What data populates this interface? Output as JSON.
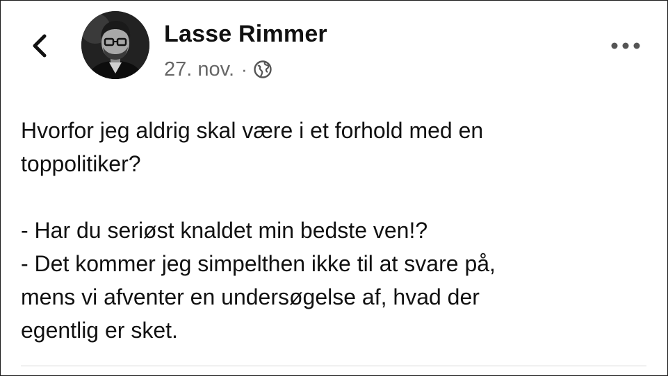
{
  "post": {
    "author_name": "Lasse Rimmer",
    "date": "27. nov.",
    "separator": "·",
    "privacy_icon": "globe-icon",
    "lines": [
      "Hvorfor jeg aldrig skal være i et forhold med en",
      "toppolitiker?",
      "",
      "- Har du seriøst knaldet min bedste ven!?",
      "- Det kommer jeg simpelthen ikke til at svare på,",
      "mens vi afventer en undersøgelse af, hvad der",
      "egentlig er sket."
    ]
  },
  "header": {
    "back_icon": "chevron-left-icon",
    "more_icon": "more-dots-icon"
  },
  "colors": {
    "text": "#111111",
    "meta": "#666666",
    "background": "#ffffff",
    "divider": "#d6d6d6"
  }
}
